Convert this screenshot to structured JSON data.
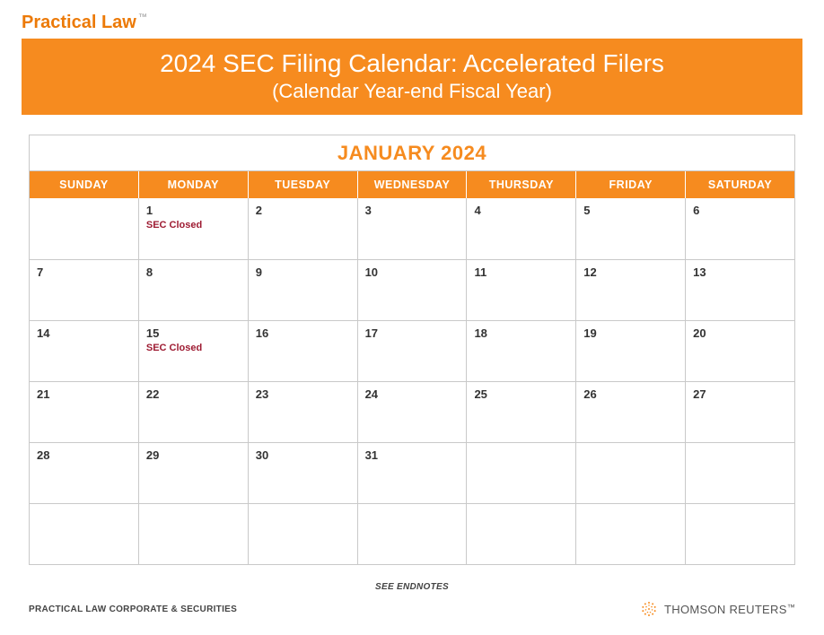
{
  "brand": {
    "name": "Practical Law",
    "tm": "™"
  },
  "title": {
    "line1": "2024 SEC Filing Calendar: Accelerated Filers",
    "line2": "(Calendar Year-end Fiscal Year)"
  },
  "month": {
    "title": "JANUARY 2024",
    "dayHeaders": [
      "SUNDAY",
      "MONDAY",
      "TUESDAY",
      "WEDNESDAY",
      "THURSDAY",
      "FRIDAY",
      "SATURDAY"
    ],
    "weeks": [
      [
        {
          "day": "",
          "note": ""
        },
        {
          "day": "1",
          "note": "SEC Closed"
        },
        {
          "day": "2",
          "note": ""
        },
        {
          "day": "3",
          "note": ""
        },
        {
          "day": "4",
          "note": ""
        },
        {
          "day": "5",
          "note": ""
        },
        {
          "day": "6",
          "note": ""
        }
      ],
      [
        {
          "day": "7",
          "note": ""
        },
        {
          "day": "8",
          "note": ""
        },
        {
          "day": "9",
          "note": ""
        },
        {
          "day": "10",
          "note": ""
        },
        {
          "day": "11",
          "note": ""
        },
        {
          "day": "12",
          "note": ""
        },
        {
          "day": "13",
          "note": ""
        }
      ],
      [
        {
          "day": "14",
          "note": ""
        },
        {
          "day": "15",
          "note": "SEC Closed"
        },
        {
          "day": "16",
          "note": ""
        },
        {
          "day": "17",
          "note": ""
        },
        {
          "day": "18",
          "note": ""
        },
        {
          "day": "19",
          "note": ""
        },
        {
          "day": "20",
          "note": ""
        }
      ],
      [
        {
          "day": "21",
          "note": ""
        },
        {
          "day": "22",
          "note": ""
        },
        {
          "day": "23",
          "note": ""
        },
        {
          "day": "24",
          "note": ""
        },
        {
          "day": "25",
          "note": ""
        },
        {
          "day": "26",
          "note": ""
        },
        {
          "day": "27",
          "note": ""
        }
      ],
      [
        {
          "day": "28",
          "note": ""
        },
        {
          "day": "29",
          "note": ""
        },
        {
          "day": "30",
          "note": ""
        },
        {
          "day": "31",
          "note": ""
        },
        {
          "day": "",
          "note": ""
        },
        {
          "day": "",
          "note": ""
        },
        {
          "day": "",
          "note": ""
        }
      ],
      [
        {
          "day": "",
          "note": ""
        },
        {
          "day": "",
          "note": ""
        },
        {
          "day": "",
          "note": ""
        },
        {
          "day": "",
          "note": ""
        },
        {
          "day": "",
          "note": ""
        },
        {
          "day": "",
          "note": ""
        },
        {
          "day": "",
          "note": ""
        }
      ]
    ]
  },
  "footer": {
    "endnotes": "SEE ENDNOTES",
    "left": "PRACTICAL LAW CORPORATE & SECURITIES",
    "right": "THOMSON REUTERS",
    "rightTm": "™"
  }
}
